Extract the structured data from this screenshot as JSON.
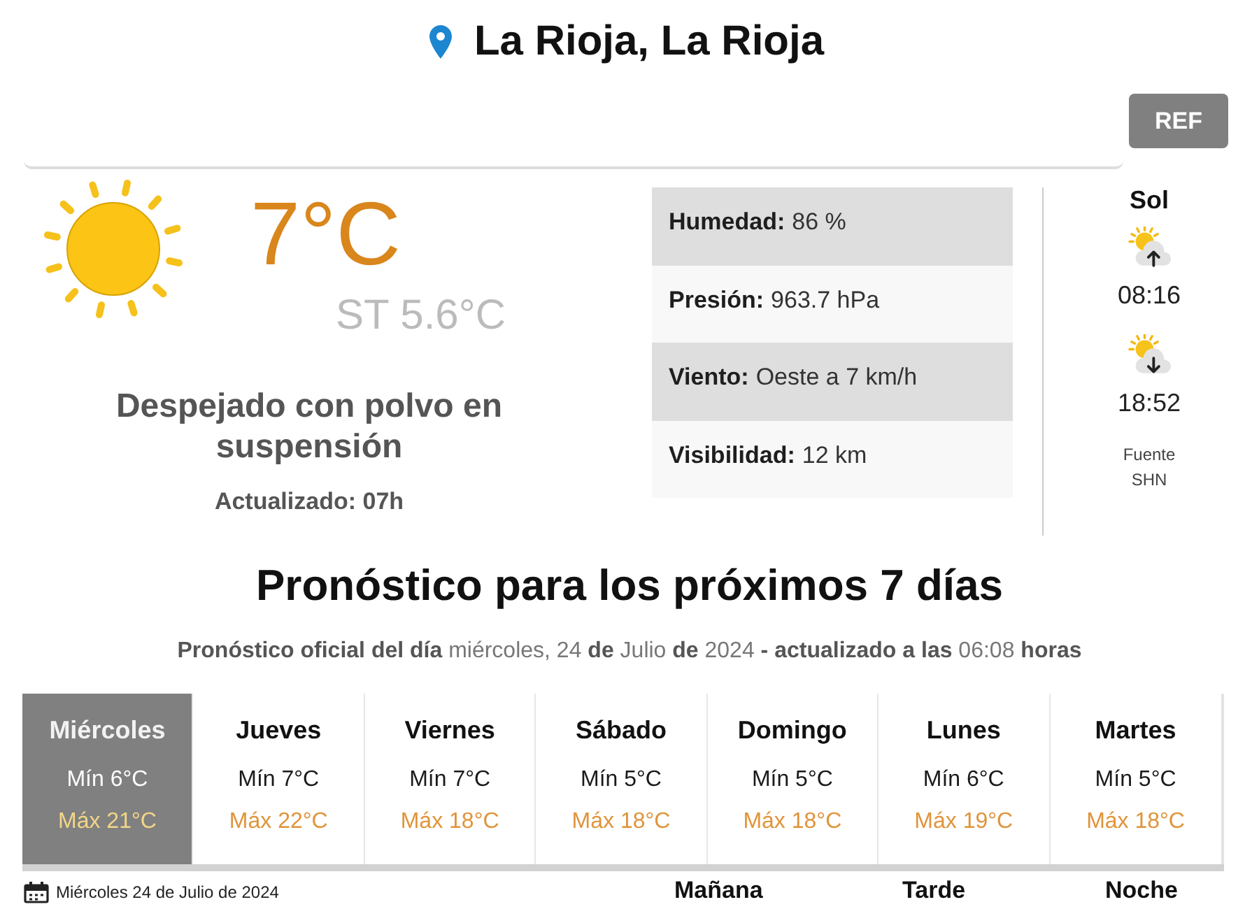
{
  "location": {
    "title": "La Rioja, La Rioja"
  },
  "toolbar": {
    "button": "REF"
  },
  "current": {
    "temperature": "7°C",
    "feels_like": "ST 5.6°C",
    "description": "Despejado con polvo en suspensión",
    "updated": "Actualizado: 07h",
    "details": [
      {
        "label": "Humedad:",
        "value": "86 %"
      },
      {
        "label": "Presión:",
        "value": "963.7 hPa"
      },
      {
        "label": "Viento:",
        "value": "Oeste a 7 km/h"
      },
      {
        "label": "Visibilidad:",
        "value": "12 km"
      }
    ]
  },
  "sun": {
    "title": "Sol",
    "events": [
      {
        "kind": "sunrise",
        "time": "08:16"
      },
      {
        "kind": "sunset",
        "time": "18:52"
      }
    ],
    "source": "Fuente SHN"
  },
  "forecast": {
    "title": "Pronóstico para los próximos 7 días",
    "subtitle": "**Pronóstico oficial del día** miércoles, 24 **de** Julio **de** 2024 **- actualizado a las** 06:08 **horas**",
    "days": [
      {
        "name": "Miércoles",
        "min": "Mín 6°C",
        "max": "Máx 21°C",
        "selected": true
      },
      {
        "name": "Jueves",
        "min": "Mín 7°C",
        "max": "Máx 22°C",
        "selected": false
      },
      {
        "name": "Viernes",
        "min": "Mín 7°C",
        "max": "Máx 18°C",
        "selected": false
      },
      {
        "name": "Sábado",
        "min": "Mín 5°C",
        "max": "Máx 18°C",
        "selected": false
      },
      {
        "name": "Domingo",
        "min": "Mín 5°C",
        "max": "Máx 18°C",
        "selected": false
      },
      {
        "name": "Lunes",
        "min": "Mín 6°C",
        "max": "Máx 19°C",
        "selected": false
      },
      {
        "name": "Martes",
        "min": "Mín 5°C",
        "max": "Máx 18°C",
        "selected": false
      }
    ]
  },
  "day_detail": {
    "date": "Miércoles 24 de Julio de 2024",
    "periods": [
      "Mañana",
      "Tarde",
      "Noche"
    ]
  }
}
